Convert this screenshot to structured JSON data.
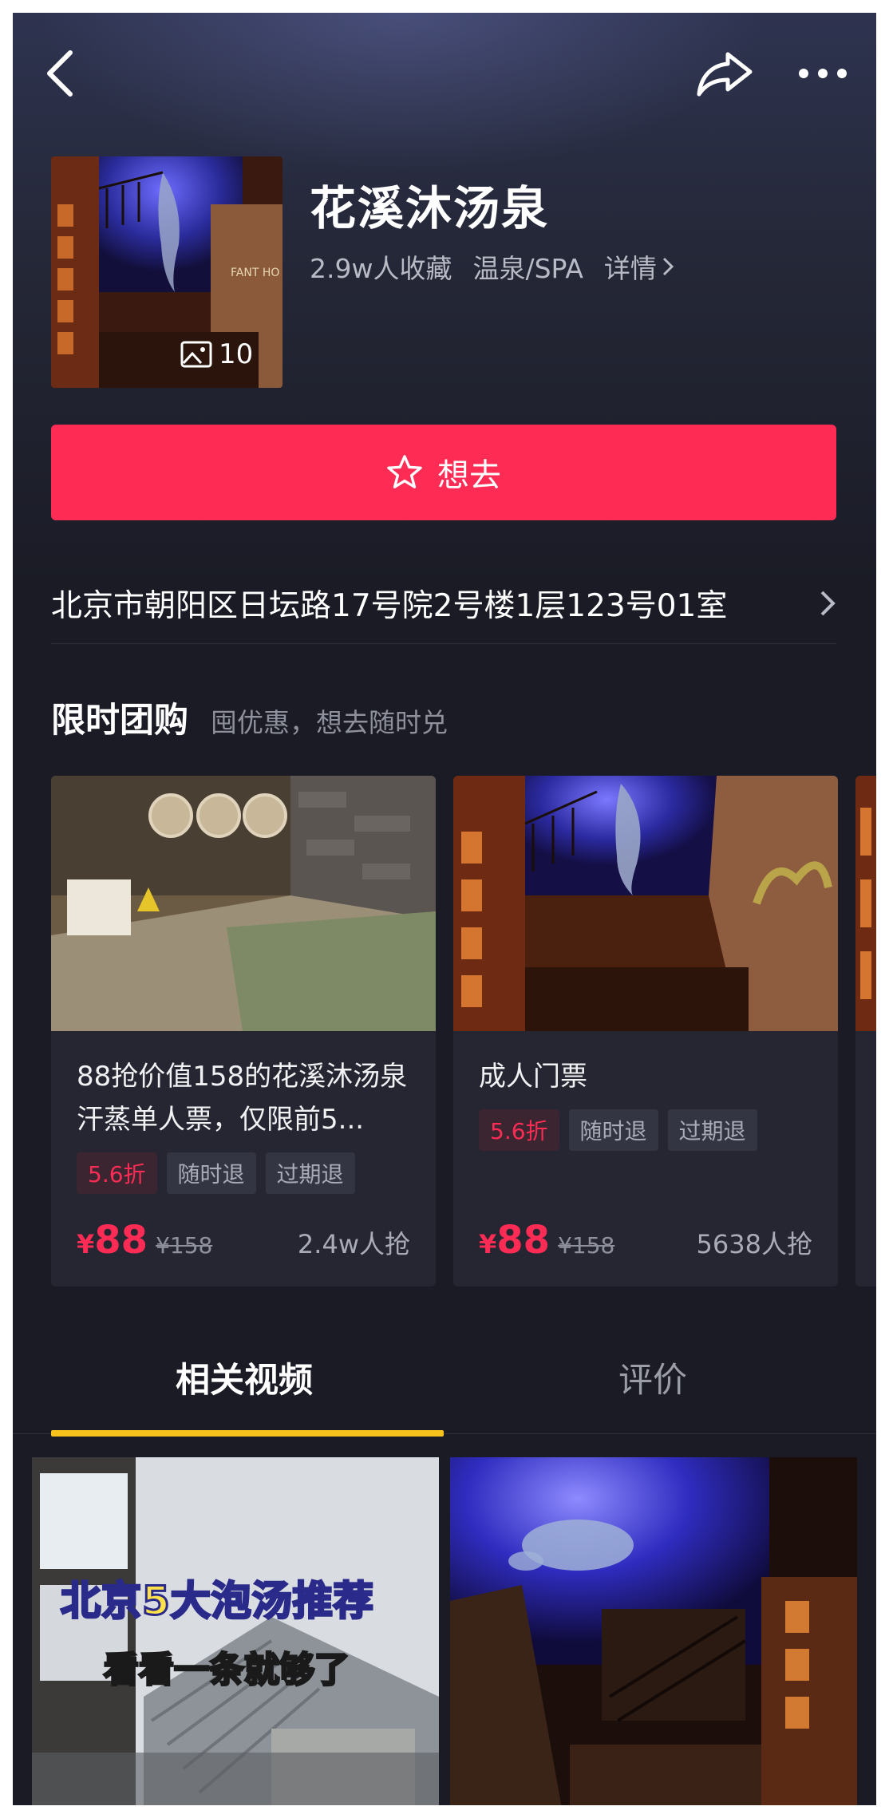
{
  "header": {
    "back_icon": "chevron-left-icon",
    "share_icon": "share-arrow-icon",
    "more_icon": "more-dots-icon"
  },
  "store": {
    "name": "花溪沐汤泉",
    "favorites": "2.9w人收藏",
    "category": "温泉/SPA",
    "details_link": "详情",
    "photo_count": "10",
    "thumb_sign_text": "FANT HO"
  },
  "want_button": {
    "label": "想去",
    "icon": "star-outline-icon",
    "color": "#fe2c55"
  },
  "address": {
    "text": "北京市朝阳区日坛路17号院2号楼1层123号01室"
  },
  "group_buy": {
    "title": "限时团购",
    "subtitle": "囤优惠，想去随时兑",
    "deals": [
      {
        "title": "88抢价值158的花溪沐汤泉汗蒸单人票，仅限前5...",
        "tags": [
          "5.6折",
          "随时退",
          "过期退"
        ],
        "currency": "¥",
        "price": "88",
        "original_price": "¥158",
        "sold": "2.4w人抢"
      },
      {
        "title": "成人门票",
        "tags": [
          "5.6折",
          "随时退",
          "过期退"
        ],
        "currency": "¥",
        "price": "88",
        "original_price": "¥158",
        "sold": "5638人抢"
      }
    ]
  },
  "tabs": [
    {
      "label": "相关视频",
      "active": true
    },
    {
      "label": "评价",
      "active": false
    }
  ],
  "videos": [
    {
      "caption_main": "北京5大泡汤推荐",
      "caption_sub": "看看一条就够了"
    },
    {
      "caption_main": "",
      "caption_sub": ""
    }
  ],
  "colors": {
    "accent": "#fe2c55",
    "tab_indicator": "#f7c21c",
    "background": "#1a1b25"
  }
}
